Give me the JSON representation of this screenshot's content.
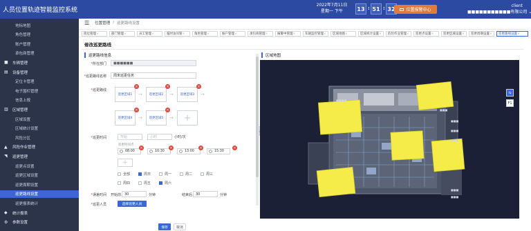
{
  "app": {
    "title": "人员位置轨迹智能监控系统",
    "date": "2022年7月11日",
    "weekday": "星期一 下午",
    "time": {
      "h": "13",
      "m": "51",
      "s": "32"
    },
    "alarm_label": "位置报警中心",
    "user": {
      "name": "client",
      "company": "■■■■■■■■■■■有限公司"
    }
  },
  "sidebar": {
    "items": [
      {
        "label": "地标地图",
        "kind": "sub"
      },
      {
        "label": "角色管理",
        "kind": "sub"
      },
      {
        "label": "账户管理",
        "kind": "sub"
      },
      {
        "label": "承包商管理",
        "kind": "sub"
      },
      {
        "label": "车辆管理",
        "kind": "sect"
      },
      {
        "label": "设备管理",
        "kind": "sect"
      },
      {
        "label": "定位卡管理",
        "kind": "sub"
      },
      {
        "label": "电子围栏管理",
        "kind": "sub"
      },
      {
        "label": "信息上报",
        "kind": "sub"
      },
      {
        "label": "区域管理",
        "kind": "sect"
      },
      {
        "label": "区域设置",
        "kind": "sub"
      },
      {
        "label": "区域统计设置",
        "kind": "sub"
      },
      {
        "label": "风险分区",
        "kind": "sub"
      },
      {
        "label": "风险作业管理",
        "kind": "sect"
      },
      {
        "label": "巡更管理",
        "kind": "sect"
      },
      {
        "label": "巡更点设置",
        "kind": "sub"
      },
      {
        "label": "巡更区域设置",
        "kind": "sub"
      },
      {
        "label": "巡更周期设置",
        "kind": "sub"
      },
      {
        "label": "巡更路线设置",
        "kind": "sub",
        "active": true
      },
      {
        "label": "巡更报表统计",
        "kind": "sub"
      },
      {
        "label": "统计报表",
        "kind": "sect"
      },
      {
        "label": "参数设置",
        "kind": "sect"
      }
    ]
  },
  "breadcrumb": {
    "home": "位置管理",
    "current": "巡更路线设置"
  },
  "tabs": [
    "岗位管理",
    "部门管理",
    "员工管理",
    "临时访问管",
    "角色管理",
    "账户管理",
    "承包商管理",
    "报警中管理",
    "车辆监控管理",
    "区域地图",
    "区域统计设置",
    "危险作业管理",
    "巡更点设置",
    "巡更区域设置",
    "巡更周期设置",
    "巡更路线设置"
  ],
  "page_title": "修改巡更路线",
  "form": {
    "section_title": "巡更路线信息",
    "department": {
      "label": "所在部门",
      "value": "■■■■■■"
    },
    "route_name": {
      "label": "巡更路线名称",
      "value": "周末巡更任务"
    },
    "route_label": "巡更路线",
    "points": [
      "巡更区域1",
      "巡更区域2",
      "巡更区域3",
      "巡更区域4",
      "巡更区域5"
    ],
    "time_label": "巡更时间",
    "time_start_placeholder": "开始",
    "time_end_placeholder": "小时",
    "time_unit": "小时/次",
    "time_hint": "巡更时间点",
    "times": [
      "08:00",
      "10:30",
      "13:00",
      "15:30"
    ],
    "days": [
      {
        "label": "全部",
        "checked": false
      },
      {
        "label": "周日",
        "checked": true
      },
      {
        "label": "周一",
        "checked": false
      },
      {
        "label": "周二",
        "checked": false
      },
      {
        "label": "周三",
        "checked": false
      },
      {
        "label": "周四",
        "checked": false
      },
      {
        "label": "周五",
        "checked": false
      },
      {
        "label": "周六",
        "checked": true
      }
    ],
    "duration_label": "误差时间",
    "before_label": "开始前",
    "before_value": "30",
    "after_label": "结束后",
    "after_value": "30",
    "minute_unit": "分钟",
    "person_label": "巡更人员",
    "person_button": "选择巡更人员",
    "save_button": "保存",
    "cancel_button": "取消"
  },
  "map": {
    "title": "区域地图",
    "floor_label": "F1",
    "compass_label": "⇆"
  },
  "colors": {
    "brand": "#2d4aa3",
    "accent": "#3b67d6",
    "alarm": "#e07b3b",
    "danger": "#e0463c",
    "highlight": "#f5ec4a"
  }
}
